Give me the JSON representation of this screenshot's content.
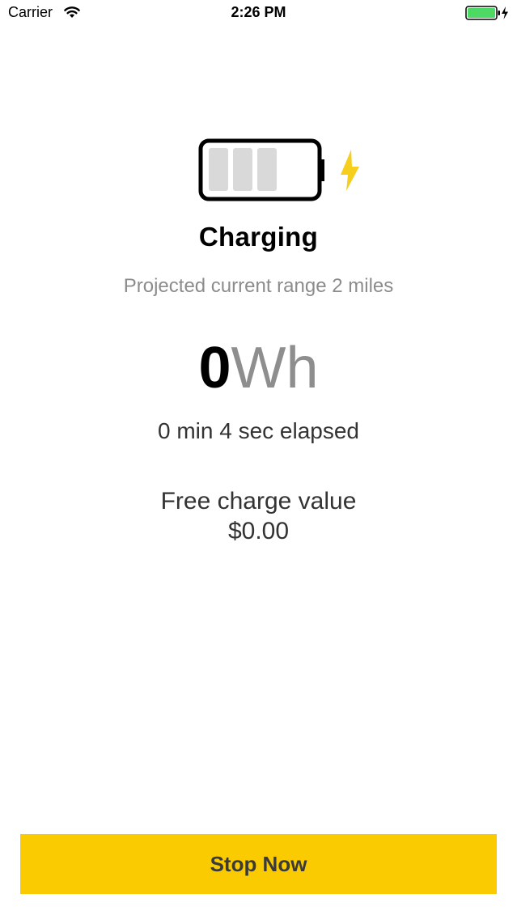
{
  "status_bar": {
    "carrier": "Carrier",
    "time": "2:26 PM",
    "icons": [
      "wifi-icon",
      "battery-charging-icon"
    ]
  },
  "charging": {
    "title": "Charging",
    "range_text": "Projected current range 2 miles",
    "energy_value": "0",
    "energy_unit": "Wh",
    "elapsed": "0 min 4 sec elapsed",
    "charge_value_label": "Free charge value",
    "charge_value": "$0.00",
    "battery_icon": "battery-icon",
    "bolt_icon": "lightning-bolt-icon"
  },
  "actions": {
    "stop_label": "Stop Now"
  },
  "colors": {
    "accent": "#F9CB00",
    "bolt": "#F5CE1E",
    "muted_text": "#8C8C8C",
    "status_battery": "#4CD964"
  }
}
